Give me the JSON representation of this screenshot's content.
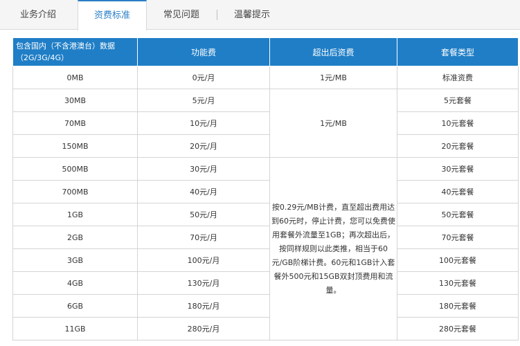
{
  "tabs": [
    {
      "label": "业务介绍",
      "active": false
    },
    {
      "label": "资费标准",
      "active": true
    },
    {
      "label": "常见问题",
      "active": false
    },
    {
      "label": "温馨提示",
      "active": false
    }
  ],
  "table": {
    "headers": [
      "包含国内（不含港澳台）数据（2G/3G/4G）",
      "功能费",
      "超出后资费",
      "套餐类型"
    ],
    "rows": [
      {
        "data": "0MB",
        "fee": "0元/月",
        "type": "标准资费"
      },
      {
        "data": "30MB",
        "fee": "5元/月",
        "type": "5元套餐"
      },
      {
        "data": "70MB",
        "fee": "10元/月",
        "type": "10元套餐"
      },
      {
        "data": "150MB",
        "fee": "20元/月",
        "type": "20元套餐"
      },
      {
        "data": "500MB",
        "fee": "30元/月",
        "type": "30元套餐"
      },
      {
        "data": "700MB",
        "fee": "40元/月",
        "type": "40元套餐"
      },
      {
        "data": "1GB",
        "fee": "50元/月",
        "type": "50元套餐"
      },
      {
        "data": "2GB",
        "fee": "70元/月",
        "type": "70元套餐"
      },
      {
        "data": "3GB",
        "fee": "100元/月",
        "type": "100元套餐"
      },
      {
        "data": "4GB",
        "fee": "130元/月",
        "type": "130元套餐"
      },
      {
        "data": "6GB",
        "fee": "180元/月",
        "type": "180元套餐"
      },
      {
        "data": "11GB",
        "fee": "280元/月",
        "type": "280元套餐"
      }
    ],
    "overage": {
      "first": "1元/MB",
      "second": "1元/MB",
      "third": "按0.29元/MB计费，直至超出费用达到60元时，停止计费，您可以免费使用套餐外流量至1GB；再次超出后，按同样规则以此类推，相当于60元/GB阶梯计费。60元和1GB计入套餐外500元和15GB双封顶费用和流量。"
    }
  },
  "colors": {
    "header_bg": "#1f7ec6",
    "active_tab": "#2a7fc6"
  }
}
